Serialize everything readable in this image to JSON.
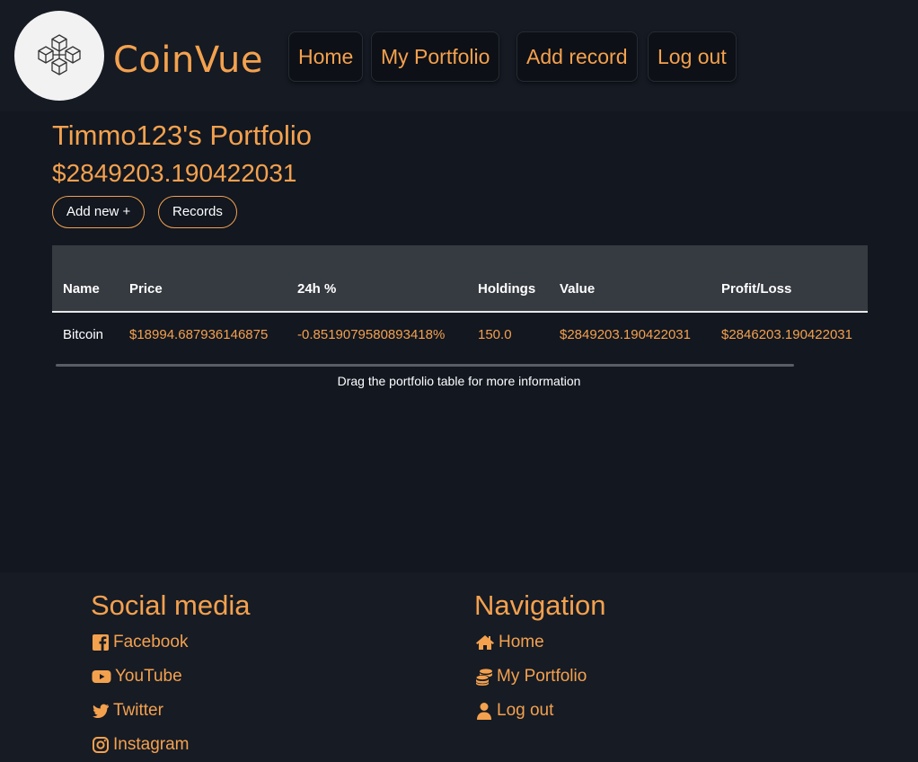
{
  "brand": {
    "name": "CoinVue"
  },
  "nav": {
    "items": [
      "Home",
      "My Portfolio",
      "Add record",
      "Log out"
    ]
  },
  "portfolio": {
    "title": "Timmo123's Portfolio",
    "total": "$2849203.190422031",
    "buttons": {
      "add_new": "Add new +",
      "records": "Records"
    },
    "table": {
      "headers": [
        "Name",
        "Price",
        "24h %",
        "Holdings",
        "Value",
        "Profit/Loss"
      ],
      "rows": [
        [
          "Bitcoin",
          "$18994.687936146875",
          "-0.8519079580893418%",
          "150.0",
          "$2849203.190422031",
          "$2846203.190422031"
        ]
      ]
    },
    "hint": "Drag the portfolio table for more information"
  },
  "footer": {
    "social": {
      "heading": "Social media",
      "links": [
        {
          "label": "Facebook",
          "icon": "facebook-icon"
        },
        {
          "label": "YouTube",
          "icon": "youtube-icon"
        },
        {
          "label": "Twitter",
          "icon": "twitter-icon"
        },
        {
          "label": "Instagram",
          "icon": "instagram-icon"
        }
      ]
    },
    "navigation": {
      "heading": "Navigation",
      "links": [
        {
          "label": "Home",
          "icon": "home-icon"
        },
        {
          "label": "My Portfolio",
          "icon": "coins-icon"
        },
        {
          "label": "Log out",
          "icon": "user-icon"
        }
      ]
    }
  },
  "colors": {
    "accent": "#f4a14e",
    "background": "#131821",
    "table_header": "#363a41"
  }
}
